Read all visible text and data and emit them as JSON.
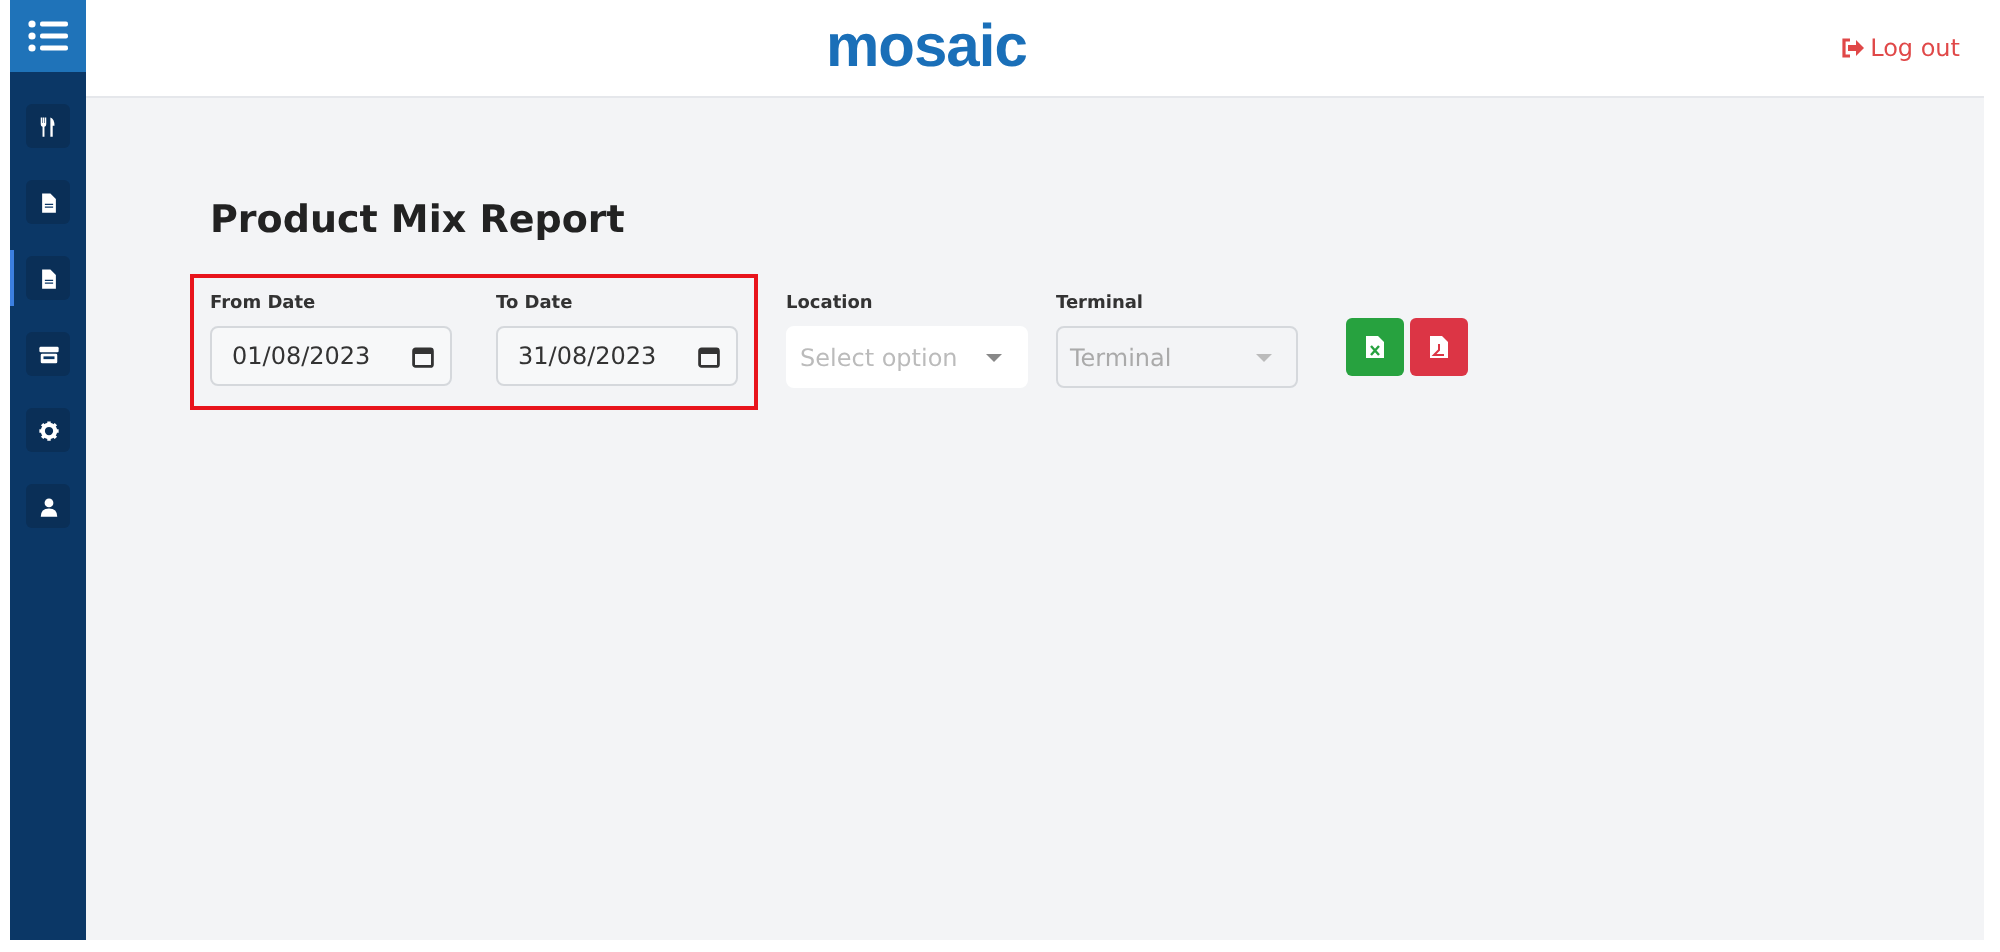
{
  "header": {
    "logo": "mosaic",
    "logout": "Log out"
  },
  "sidebar": {
    "items": [
      {
        "selected": false
      },
      {
        "selected": false
      },
      {
        "selected": true
      },
      {
        "selected": false
      },
      {
        "selected": false
      },
      {
        "selected": false
      }
    ]
  },
  "page": {
    "title": "Product Mix Report"
  },
  "filters": [
    {
      "kind": "date",
      "label": "From Date",
      "value": "01/08/2023",
      "highlighted": true
    },
    {
      "kind": "date",
      "label": "To Date",
      "value": "31/08/2023",
      "highlighted": true
    },
    {
      "kind": "select",
      "label": "Location",
      "placeholder": "Select option",
      "disabled": false
    },
    {
      "kind": "select",
      "label": "Terminal",
      "placeholder": "Terminal",
      "disabled": true
    }
  ],
  "exports": [
    {
      "kind": "excel"
    },
    {
      "kind": "pdf"
    }
  ]
}
